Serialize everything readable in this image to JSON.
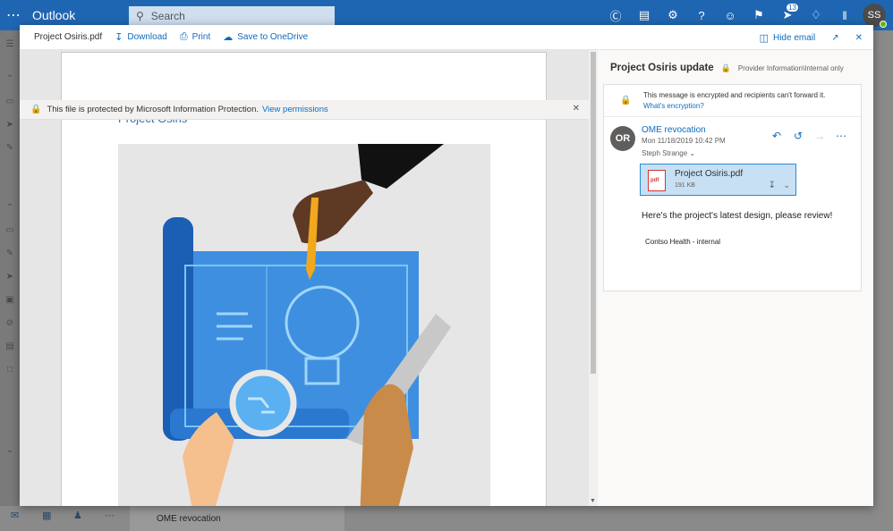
{
  "app": {
    "name": "Outlook",
    "search_placeholder": "Search",
    "notification_count": "13",
    "user_initials": "SS"
  },
  "viewer": {
    "file_name": "Project Osiris.pdf",
    "toolbar": {
      "download": "Download",
      "print": "Print",
      "save": "Save to OneDrive",
      "hide_email": "Hide email"
    },
    "protection": {
      "message": "This file is protected by Microsoft Information Protection.",
      "link": "View permissions"
    },
    "page_title": "Project Osiris"
  },
  "email": {
    "subject": "Project Osiris update",
    "label": "Provider Information\\Internal only",
    "encryption_notice": "This message is encrypted and recipients can't forward it.",
    "encryption_link": "What's encryption?",
    "sender_initials": "OR",
    "sender": "OME revocation",
    "date": "Mon 11/18/2019 10:42 PM",
    "to": "Steph Strange",
    "attachment": {
      "name": "Project Osiris.pdf",
      "size": "191 KB",
      "type": "pdf"
    },
    "body": "Here's the project's latest design, please review!",
    "signature": "Contso Health - internal"
  },
  "background_list": {
    "sender": "OME revocation"
  },
  "colors": {
    "brand": "#1f66b2",
    "link": "#0f6cbd",
    "attachment_bg": "#c7e0f4"
  }
}
